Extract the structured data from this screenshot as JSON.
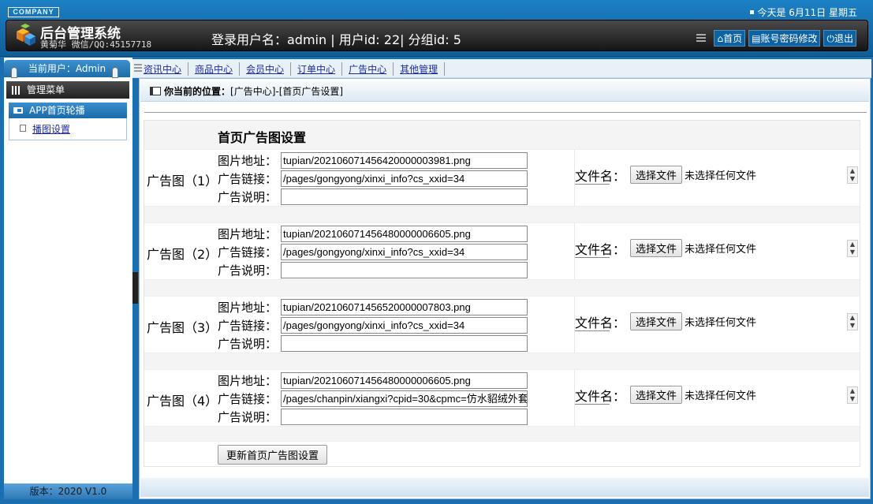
{
  "header": {
    "company": "COMPANY",
    "date_text": "今天是 6月11日 星期五",
    "app_title": "后台管理系统",
    "app_sub": "黄菊华 微信/QQ:45157718",
    "login_info": "登录用户名：admin | 用户id: 22| 分组id: 5",
    "links": [
      "首页",
      "账号密码修改",
      "退出"
    ]
  },
  "sidebar": {
    "user_tab": "当前用户：Admin",
    "menu_head": "管理菜单",
    "section": "APP首页轮播",
    "items": [
      "播图设置"
    ],
    "version": "版本：2020 V1.0"
  },
  "nav": {
    "items": [
      "资讯中心",
      "商品中心",
      "会员中心",
      "订单中心",
      "广告中心",
      "其他管理"
    ]
  },
  "breadcrumb": {
    "label": "你当前的位置：",
    "path": "[广告中心]-[首页广告设置]"
  },
  "form": {
    "title": "首页广告图设置",
    "field_labels": [
      "图片地址：",
      "广告链接：",
      "广告说明："
    ],
    "file_label": "文件名：",
    "file_button": "选择文件",
    "file_none": "未选择任何文件",
    "ads": [
      {
        "label": "广告图（1）",
        "image": "tupian/20210607145642000000398​1.png",
        "link": "/pages/gongyong/xinxi_info?cs_xxid=34",
        "desc": ""
      },
      {
        "label": "广告图（2）",
        "image": "tupian/20210607145648000000660​5.png",
        "link": "/pages/gongyong/xinxi_info?cs_xxid=34",
        "desc": ""
      },
      {
        "label": "广告图（3）",
        "image": "tupian/20210607145652000000780​3.png",
        "link": "/pages/gongyong/xinxi_info?cs_xxid=34",
        "desc": ""
      },
      {
        "label": "广告图（4）",
        "image": "tupian/20210607145648000000660​5.png",
        "link": "/pages/chanpin/xiangxi?cpid=30&cpmc=仿水貂绒外套",
        "desc": ""
      }
    ],
    "submit": "更新首页广告图设置"
  }
}
